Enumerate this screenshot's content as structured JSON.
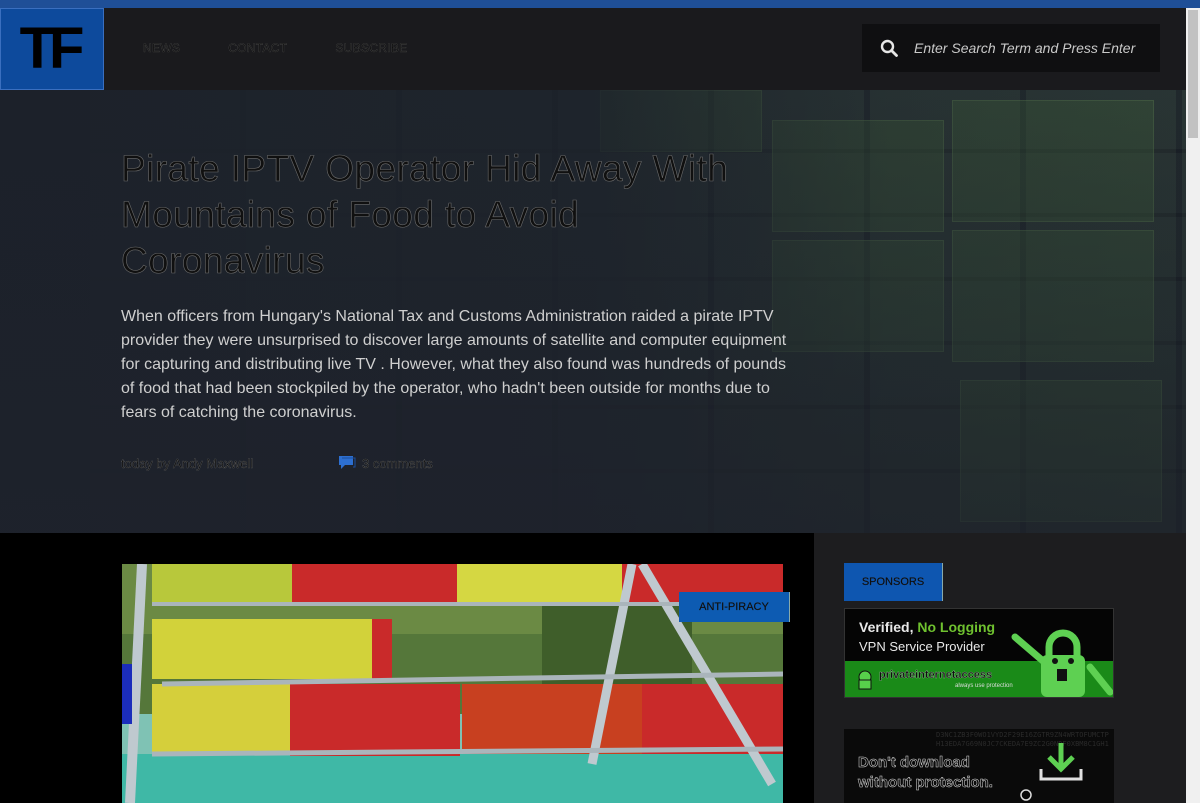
{
  "header": {
    "logo_text": "TF",
    "nav": [
      "NEWS",
      "CONTACT",
      "SUBSCRIBE"
    ],
    "search_placeholder": "Enter Search Term and Press Enter"
  },
  "article": {
    "title": "Pirate IPTV Operator Hid Away With Mountains of Food to Avoid Coronavirus",
    "lede": "When officers from Hungary's National Tax and Customs Administration raided a pirate IPTV provider they were unsurprised to discover large amounts of satellite and computer equipment for capturing and distributing live TV . However, what they also found was hundreds of pounds of food that had been stockpiled by the operator, who hadn't been outside for months due to fears of catching the coronavirus.",
    "byline": "today by Andy Maxwell",
    "comments": "3 comments",
    "category": "ANTI-PIRACY"
  },
  "sidebar": {
    "heading": "SPONSORS",
    "ad1": {
      "line1_prefix": "Verified, ",
      "line1_highlight": "No Logging",
      "line2": "VPN Service Provider",
      "brand": "privateinternetaccess",
      "tagline": "always use protection"
    },
    "ad2": {
      "line1": "Don't download",
      "line2": "without protection.",
      "code": "D3NC1ZB3F0WO1VYD2F29E16ZGTR9ZN4WRTOFUMCTPH13EDA7G69N0JC7CKEDA7E9ZC2G0NDF0XBM8C1GH1"
    }
  },
  "colors": {
    "brand_blue": "#0d4a9c",
    "header_bg": "#1a1a1d",
    "vpn_green": "#1a8a18"
  }
}
